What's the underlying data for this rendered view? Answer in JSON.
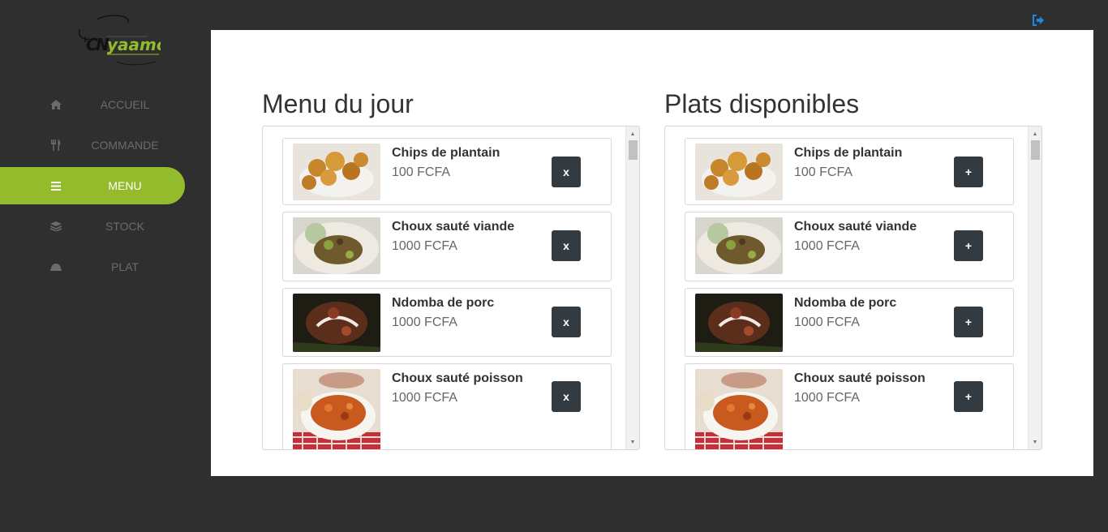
{
  "brand": {
    "logo_alt": "Nyaamo"
  },
  "sidebar": {
    "items": [
      {
        "label": "ACCUEIL",
        "icon": "home-icon",
        "active": false
      },
      {
        "label": "COMMANDE",
        "icon": "cutlery-icon",
        "active": false
      },
      {
        "label": "MENU",
        "icon": "list-icon",
        "active": true
      },
      {
        "label": "STOCK",
        "icon": "layers-icon",
        "active": false
      },
      {
        "label": "PLAT",
        "icon": "cloche-icon",
        "active": false
      }
    ]
  },
  "header": {
    "logout_icon": "sign-out-icon"
  },
  "menu_du_jour": {
    "title": "Menu du jour",
    "items": [
      {
        "name": "Chips de plantain",
        "price": "100 FCFA",
        "action": "x"
      },
      {
        "name": "Choux sauté viande",
        "price": "1000 FCFA",
        "action": "x"
      },
      {
        "name": "Ndomba de porc",
        "price": "1000 FCFA",
        "action": "x"
      },
      {
        "name": "Choux sauté poisson",
        "price": "1000 FCFA",
        "action": "x"
      }
    ]
  },
  "plats_disponibles": {
    "title": "Plats disponibles",
    "items": [
      {
        "name": "Chips de plantain",
        "price": "100 FCFA",
        "action": "+"
      },
      {
        "name": "Choux sauté viande",
        "price": "1000 FCFA",
        "action": "+"
      },
      {
        "name": "Ndomba de porc",
        "price": "1000 FCFA",
        "action": "+"
      },
      {
        "name": "Choux sauté poisson",
        "price": "1000 FCFA",
        "action": "+"
      }
    ]
  },
  "colors": {
    "accent": "#93bb2b",
    "sidebar_bg": "#2f2f2f",
    "button_dark": "#333a40",
    "logout": "#1e88e5"
  }
}
